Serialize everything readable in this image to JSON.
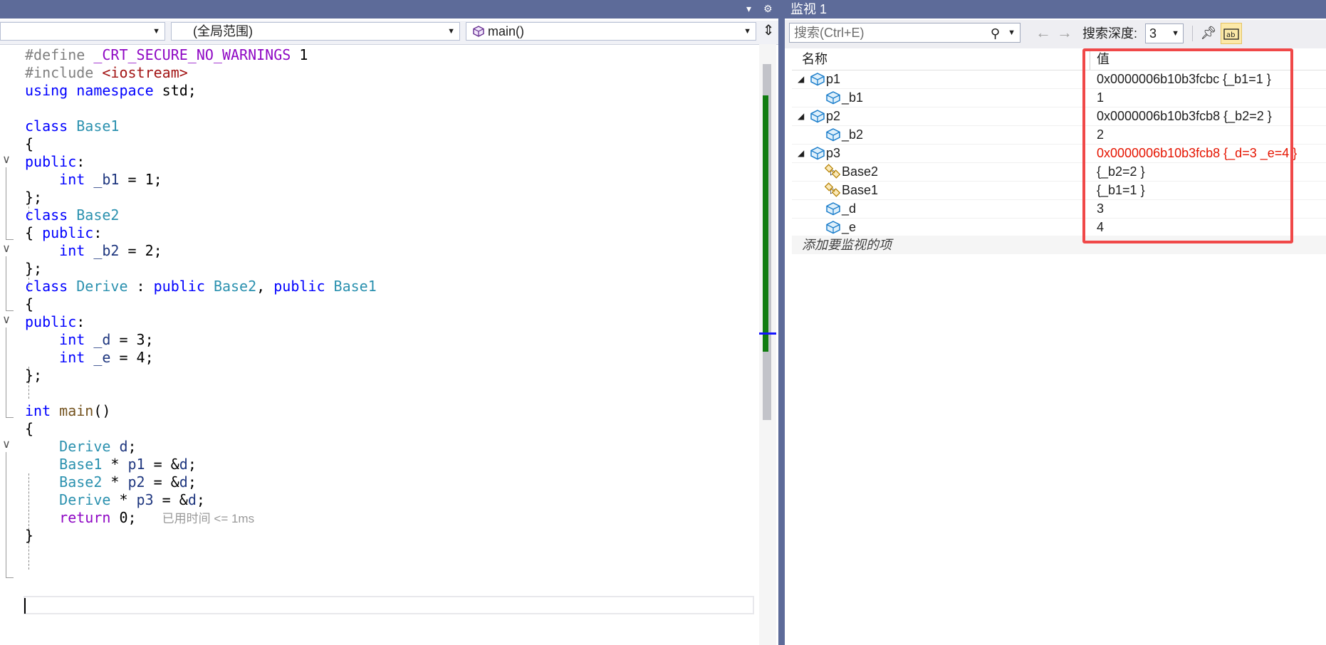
{
  "editor": {
    "nav": {
      "project_combo": "",
      "scope_combo": "(全局范围)",
      "member_combo": "main()"
    },
    "lines": [
      {
        "tokens": [
          [
            "pp",
            "#define "
          ],
          [
            "mac",
            "_CRT_SECURE_NO_WARNINGS"
          ],
          [
            "",
            " 1"
          ]
        ]
      },
      {
        "tokens": [
          [
            "pp",
            "#include "
          ],
          [
            "str",
            "<iostream>"
          ]
        ]
      },
      {
        "tokens": [
          [
            "kw",
            "using"
          ],
          [
            "",
            " "
          ],
          [
            "kw",
            "namespace"
          ],
          [
            "",
            " std;"
          ]
        ]
      },
      {
        "tokens": []
      },
      {
        "tokens": [
          [
            "kw",
            "class"
          ],
          [
            "",
            " "
          ],
          [
            "ty",
            "Base1"
          ]
        ]
      },
      {
        "tokens": [
          [
            "",
            "{"
          ]
        ]
      },
      {
        "tokens": [
          [
            "kw",
            "public"
          ],
          [
            "",
            ":"
          ]
        ]
      },
      {
        "tokens": [
          [
            "",
            "    "
          ],
          [
            "kw",
            "int"
          ],
          [
            "",
            " "
          ],
          [
            "var",
            "_b1"
          ],
          [
            "",
            " = 1;"
          ]
        ]
      },
      {
        "tokens": [
          [
            "",
            "};"
          ]
        ]
      },
      {
        "tokens": [
          [
            "kw",
            "class"
          ],
          [
            "",
            " "
          ],
          [
            "ty",
            "Base2"
          ]
        ]
      },
      {
        "tokens": [
          [
            "",
            "{ "
          ],
          [
            "kw",
            "public"
          ],
          [
            "",
            ":"
          ]
        ]
      },
      {
        "tokens": [
          [
            "",
            "    "
          ],
          [
            "kw",
            "int"
          ],
          [
            "",
            " "
          ],
          [
            "var",
            "_b2"
          ],
          [
            "",
            " = 2;"
          ]
        ]
      },
      {
        "tokens": [
          [
            "",
            "};"
          ]
        ]
      },
      {
        "tokens": [
          [
            "kw",
            "class"
          ],
          [
            "",
            " "
          ],
          [
            "ty",
            "Derive"
          ],
          [
            "",
            " : "
          ],
          [
            "kw",
            "public"
          ],
          [
            "",
            " "
          ],
          [
            "ty",
            "Base2"
          ],
          [
            "",
            ", "
          ],
          [
            "kw",
            "public"
          ],
          [
            "",
            " "
          ],
          [
            "ty",
            "Base1"
          ]
        ]
      },
      {
        "tokens": [
          [
            "",
            "{"
          ]
        ]
      },
      {
        "tokens": [
          [
            "kw",
            "public"
          ],
          [
            "",
            ":"
          ]
        ]
      },
      {
        "tokens": [
          [
            "",
            "    "
          ],
          [
            "kw",
            "int"
          ],
          [
            "",
            " "
          ],
          [
            "var",
            "_d"
          ],
          [
            "",
            " = 3;"
          ]
        ]
      },
      {
        "tokens": [
          [
            "",
            "    "
          ],
          [
            "kw",
            "int"
          ],
          [
            "",
            " "
          ],
          [
            "var",
            "_e"
          ],
          [
            "",
            " = 4;"
          ]
        ]
      },
      {
        "tokens": [
          [
            "",
            "};"
          ]
        ]
      },
      {
        "tokens": []
      },
      {
        "tokens": [
          [
            "kw",
            "int"
          ],
          [
            "",
            " "
          ],
          [
            "fn",
            "main"
          ],
          [
            "",
            "()"
          ]
        ]
      },
      {
        "tokens": [
          [
            "",
            "{"
          ]
        ]
      },
      {
        "tokens": [
          [
            "",
            "    "
          ],
          [
            "ty",
            "Derive"
          ],
          [
            "",
            " "
          ],
          [
            "var",
            "d"
          ],
          [
            "",
            ";"
          ]
        ]
      },
      {
        "tokens": [
          [
            "",
            "    "
          ],
          [
            "ty",
            "Base1"
          ],
          [
            "",
            " * "
          ],
          [
            "var",
            "p1"
          ],
          [
            "",
            " = &"
          ],
          [
            "var",
            "d"
          ],
          [
            "",
            ";"
          ]
        ]
      },
      {
        "tokens": [
          [
            "",
            "    "
          ],
          [
            "ty",
            "Base2"
          ],
          [
            "",
            " * "
          ],
          [
            "var",
            "p2"
          ],
          [
            "",
            " = &"
          ],
          [
            "var",
            "d"
          ],
          [
            "",
            ";"
          ]
        ]
      },
      {
        "tokens": [
          [
            "",
            "    "
          ],
          [
            "ty",
            "Derive"
          ],
          [
            "",
            " * "
          ],
          [
            "var",
            "p3"
          ],
          [
            "",
            " = &"
          ],
          [
            "var",
            "d"
          ],
          [
            "",
            ";"
          ]
        ]
      },
      {
        "tokens": [
          [
            "",
            "    "
          ],
          [
            "ctl",
            "return"
          ],
          [
            "",
            " 0;   "
          ],
          [
            "hint",
            "已用时间 <= 1ms"
          ]
        ]
      },
      {
        "tokens": [
          [
            "",
            "}"
          ]
        ]
      }
    ]
  },
  "watch": {
    "title": "监视 1",
    "search_placeholder": "搜索(Ctrl+E)",
    "depth_label": "搜索深度:",
    "depth_value": "3",
    "col_name": "名称",
    "col_value": "值",
    "add_item": "添加要监视的项",
    "rows": [
      {
        "name": "p1",
        "value": "0x0000006b10b3fcbc {_b1=1 }",
        "level": 0,
        "expander": "expanded",
        "icon": "field-cube-icon",
        "changed": false
      },
      {
        "name": "_b1",
        "value": "1",
        "level": 1,
        "expander": "none",
        "icon": "field-cube-icon",
        "changed": false
      },
      {
        "name": "p2",
        "value": "0x0000006b10b3fcb8 {_b2=2 }",
        "level": 0,
        "expander": "expanded",
        "icon": "field-cube-icon",
        "changed": false
      },
      {
        "name": "_b2",
        "value": "2",
        "level": 1,
        "expander": "none",
        "icon": "field-cube-icon",
        "changed": false
      },
      {
        "name": "p3",
        "value": "0x0000006b10b3fcb8 {_d=3 _e=4 }",
        "level": 0,
        "expander": "expanded",
        "icon": "field-cube-icon",
        "changed": true
      },
      {
        "name": "Base2",
        "value": "{_b2=2 }",
        "level": 1,
        "expander": "collapsed",
        "icon": "base-class-icon",
        "changed": false
      },
      {
        "name": "Base1",
        "value": "{_b1=1 }",
        "level": 1,
        "expander": "collapsed",
        "icon": "base-class-icon",
        "changed": false
      },
      {
        "name": "_d",
        "value": "3",
        "level": 1,
        "expander": "none",
        "icon": "field-cube-icon",
        "changed": false
      },
      {
        "name": "_e",
        "value": "4",
        "level": 1,
        "expander": "none",
        "icon": "field-cube-icon",
        "changed": false
      }
    ]
  },
  "colors": {
    "title_bar": "#5d6b99",
    "highlight_box": "#f04848",
    "changed_value": "#e51400"
  }
}
